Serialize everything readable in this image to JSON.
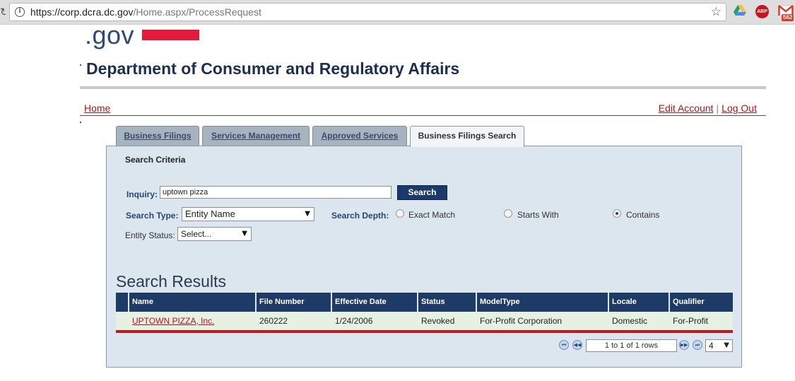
{
  "browser": {
    "url_host": "https://corp.dcra.dc.gov",
    "url_path": "/Home.aspx/ProcessRequest",
    "mail_badge": "562",
    "abp_label": "ABP"
  },
  "site": {
    "logo_text": ".gov",
    "title": "Department of Consumer and Regulatory Affairs",
    "accent_color": "#e31b3b"
  },
  "nav": {
    "home": "Home",
    "edit_account": "Edit Account",
    "separator": "|",
    "logout": "Log Out"
  },
  "tabs": [
    {
      "label": "Business Filings",
      "active": false
    },
    {
      "label": "Services Management",
      "active": false
    },
    {
      "label": "Approved Services",
      "active": false
    },
    {
      "label": "Business Filings Search",
      "active": true
    }
  ],
  "search": {
    "criteria_title": "Search Criteria",
    "inquiry_label": "Inquiry:",
    "inquiry_value": "uptown pizza",
    "button": "Search",
    "type_label": "Search Type:",
    "type_value": "Entity Name",
    "depth_label": "Search Depth:",
    "depth_options": [
      "Exact Match",
      "Starts With",
      "Contains"
    ],
    "depth_selected": "Contains",
    "status_label": "Entity Status:",
    "status_value": "Select..."
  },
  "results": {
    "title": "Search Results",
    "columns": [
      "Name",
      "File Number",
      "Effective Date",
      "Status",
      "ModelType",
      "Locale",
      "Qualifier"
    ],
    "rows": [
      {
        "name": "UPTOWN PIZZA, Inc.",
        "file_number": "260222",
        "effective_date": "1/24/2006",
        "status": "Revoked",
        "model_type": "For-Profit Corporation",
        "locale": "Domestic",
        "qualifier": "For-Profit"
      }
    ],
    "pager_info": "1 to 1 of 1 rows",
    "page_size": "4"
  }
}
